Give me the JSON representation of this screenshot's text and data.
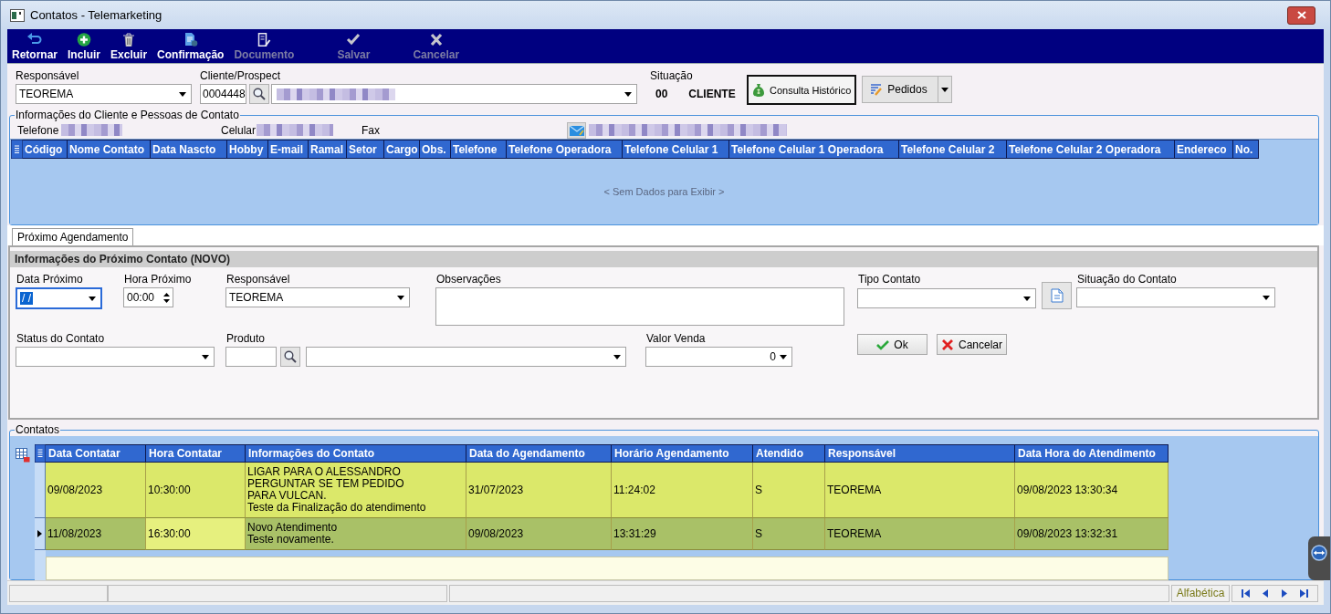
{
  "window": {
    "title": "Contatos - Telemarketing"
  },
  "toolbar": [
    {
      "label": "Retornar",
      "disabled": false
    },
    {
      "label": "Incluir",
      "disabled": false
    },
    {
      "label": "Excluir",
      "disabled": false
    },
    {
      "label": "Confirmação",
      "disabled": false
    },
    {
      "label": "Documento",
      "disabled": true
    },
    {
      "label": "Salvar",
      "disabled": true
    },
    {
      "label": "Cancelar",
      "disabled": true
    }
  ],
  "header": {
    "responsible": {
      "label": "Responsável",
      "value": "TEOREMA"
    },
    "client": {
      "label": "Cliente/Prospect",
      "code": "0004448",
      "name_redacted": true
    },
    "status": {
      "label": "Situação",
      "code": "00",
      "value": "CLIENTE"
    },
    "buttons": [
      {
        "label": "Consulta Histórico",
        "focused": true
      },
      {
        "label": "Pedidos",
        "focused": false
      }
    ]
  },
  "client_info": {
    "title": "Informações do Cliente e Pessoas de Contato",
    "phones": [
      {
        "label": "Telefone",
        "redacted": true
      },
      {
        "label": "Celular",
        "redacted": true
      },
      {
        "label": "Fax",
        "redacted": false
      }
    ],
    "email_redacted": true,
    "columns": [
      "Código",
      "Nome Contato",
      "Data Nascto",
      "Hobby",
      "E-mail",
      "Ramal",
      "Setor",
      "Cargo",
      "Obs.",
      "Telefone",
      "Telefone Operadora",
      "Telefone Celular 1",
      "Telefone Celular 1 Operadora",
      "Telefone Celular 2",
      "Telefone Celular 2 Operadora",
      "Endereco",
      "No."
    ],
    "empty_text": "< Sem Dados para Exibir >"
  },
  "tabs": [
    {
      "label": "Próximo Agendamento",
      "selected": true
    }
  ],
  "next_contact": {
    "title": "Informações do Próximo Contato (NOVO)",
    "fields": [
      {
        "kind": "date",
        "label": "Data Próximo",
        "value": "/ /",
        "focused": true
      },
      {
        "kind": "time",
        "label": "Hora Próximo",
        "value": "00:00",
        "focused": false
      },
      {
        "kind": "combo",
        "label": "Responsável",
        "value": "TEOREMA",
        "focused": false
      },
      {
        "kind": "memo",
        "label": "Observações",
        "focused": false
      },
      {
        "kind": "combo_button",
        "label": "Tipo Contato",
        "focused": false
      },
      {
        "kind": "combo",
        "label": "Situação do Contato",
        "focused": false
      },
      {
        "kind": "combo",
        "label": "Status do Contato",
        "focused": false
      },
      {
        "kind": "lookup",
        "label": "Produto",
        "focused": false
      },
      {
        "kind": "number",
        "label": "Valor Venda",
        "value": "0",
        "focused": false
      }
    ],
    "buttons": [
      {
        "kind": "ok",
        "label": "Ok"
      },
      {
        "kind": "cancel",
        "label": "Cancelar"
      }
    ]
  },
  "contacts": {
    "title": "Contatos",
    "columns": [
      "Data Contatar",
      "Hora Contatar",
      "Informações do Contato",
      "Data do Agendamento",
      "Horário Agendamento",
      "Atendido",
      "Responsável",
      "Data Hora do Atendimento"
    ],
    "rows": [
      {
        "selected": false,
        "cells": [
          {
            "text": "09/08/2023",
            "focused": false
          },
          {
            "text": "10:30:00",
            "focused": false
          },
          {
            "text": "LIGAR PARA O ALESSANDRO\nPERGUNTAR SE TEM PEDIDO\nPARA VULCAN.\nTeste da Finalização do atendimento",
            "focused": false
          },
          {
            "text": "31/07/2023",
            "focused": false
          },
          {
            "text": "11:24:02",
            "focused": false
          },
          {
            "text": "S",
            "focused": false
          },
          {
            "text": "TEOREMA",
            "focused": false
          },
          {
            "text": "09/08/2023 13:30:34",
            "focused": false
          }
        ]
      },
      {
        "selected": true,
        "cells": [
          {
            "text": "11/08/2023",
            "focused": false
          },
          {
            "text": "16:30:00",
            "focused": true
          },
          {
            "text": "Novo Atendimento\nTeste novamente.",
            "focused": false
          },
          {
            "text": "09/08/2023",
            "focused": false
          },
          {
            "text": "13:31:29",
            "focused": false
          },
          {
            "text": "S",
            "focused": false
          },
          {
            "text": "TEOREMA",
            "focused": false
          },
          {
            "text": "09/08/2023 13:32:31",
            "focused": false
          }
        ]
      }
    ]
  },
  "status_bar": {
    "sort": "Alfabética"
  }
}
